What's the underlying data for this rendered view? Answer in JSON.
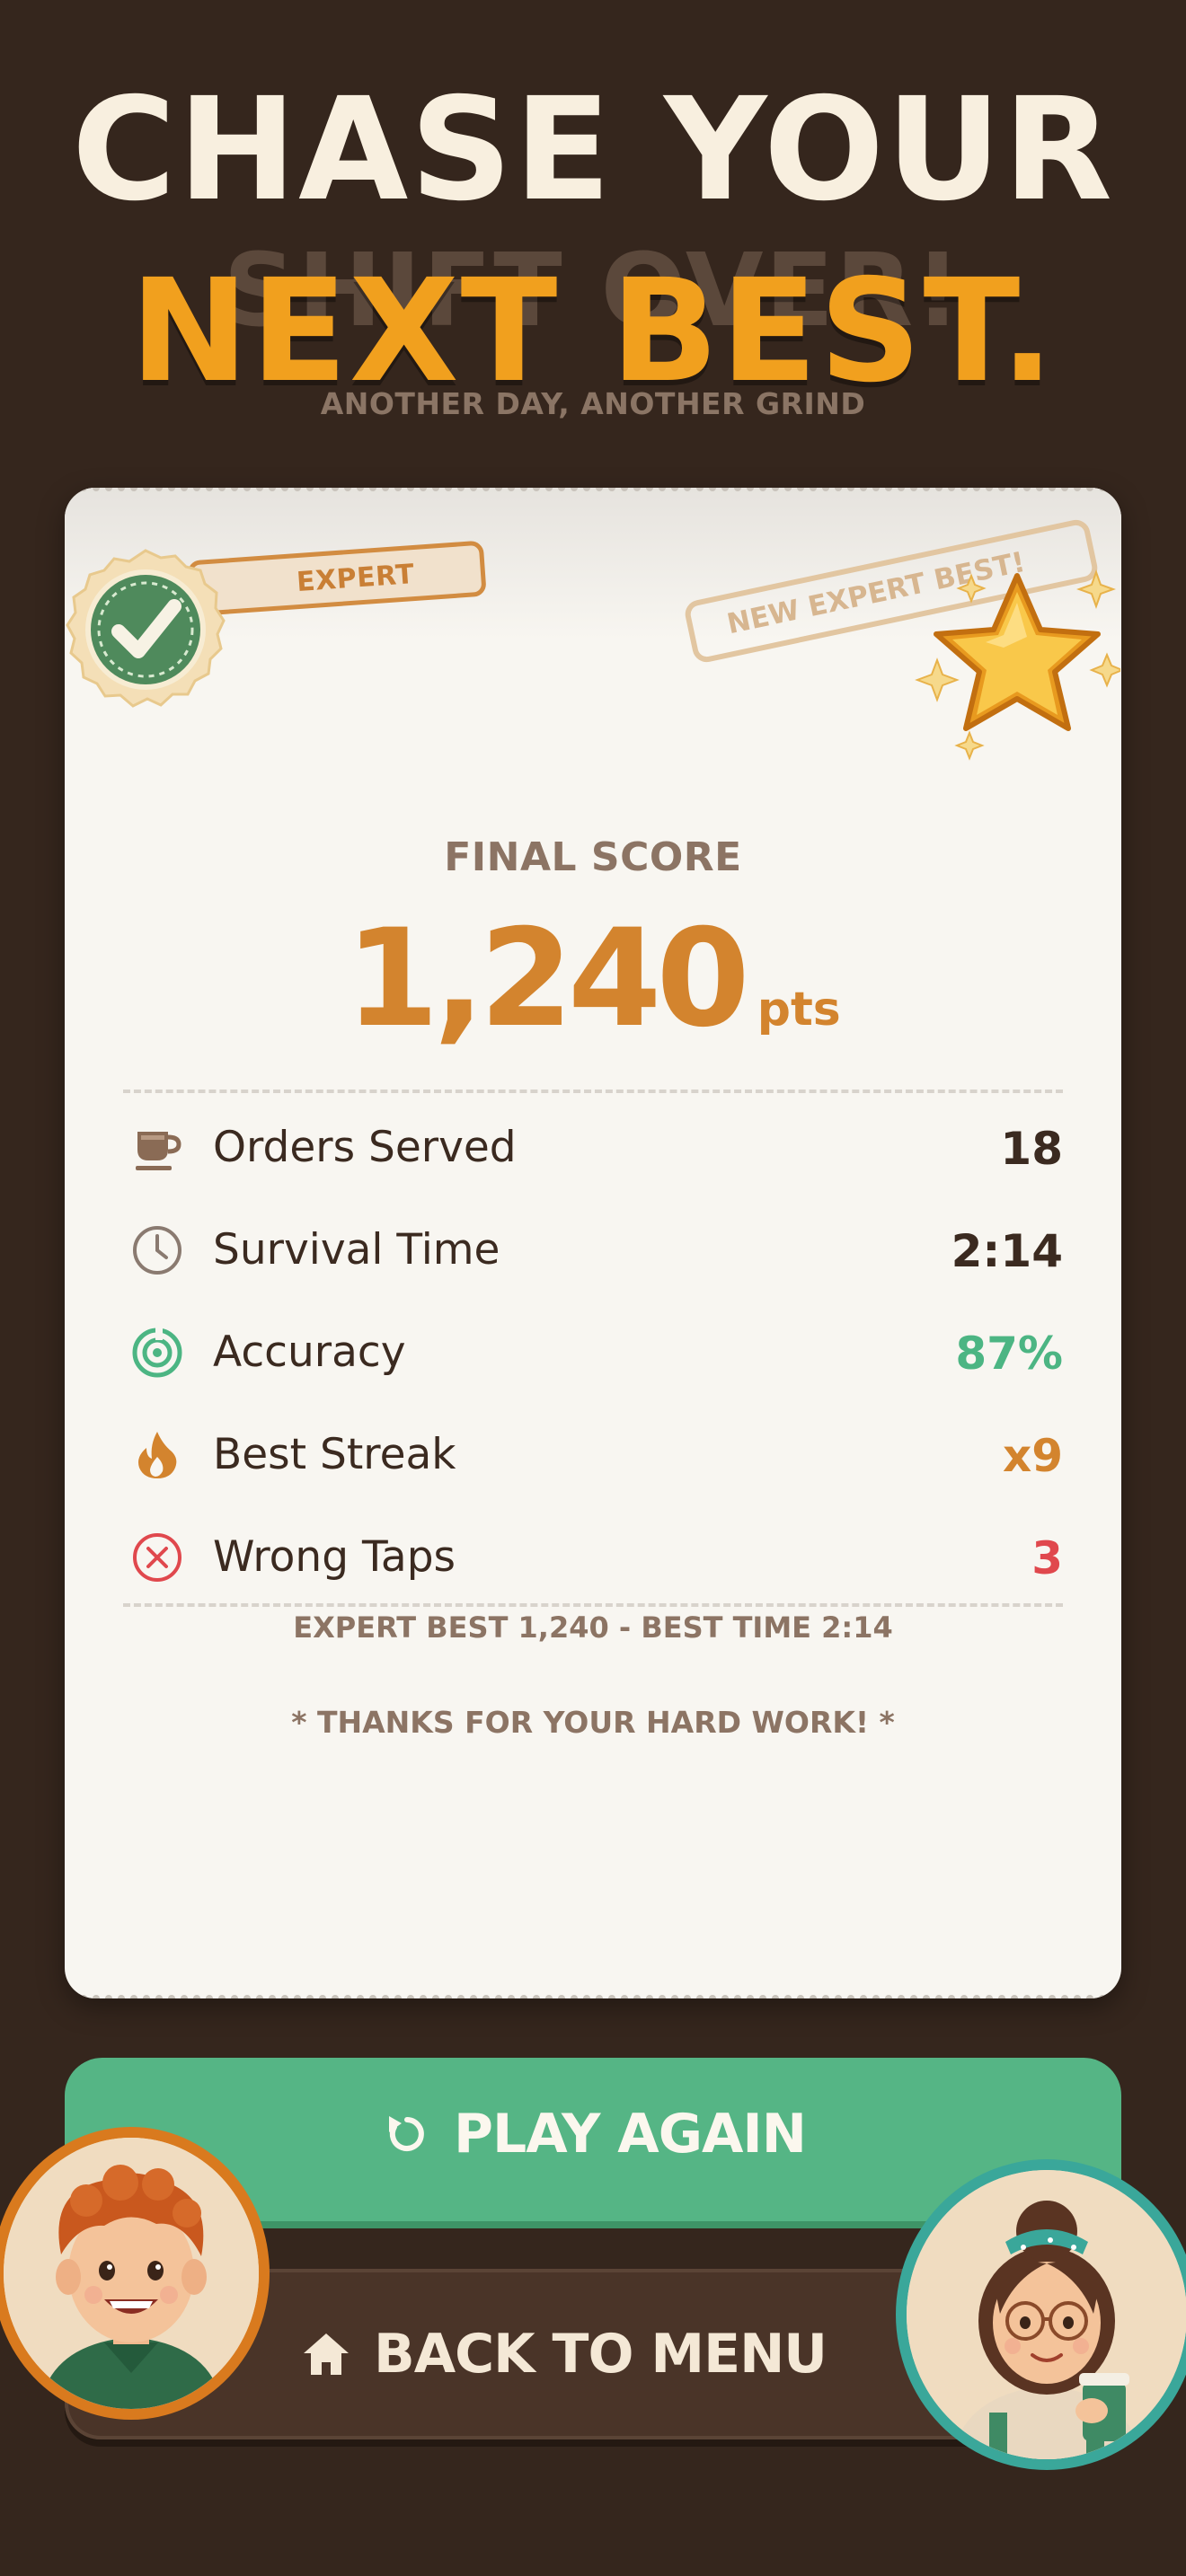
{
  "headline": {
    "line1": "CHASE YOUR",
    "line2": "NEXT BEST.",
    "ghost": "SHIFT OVER!",
    "subtitle": "ANOTHER DAY, ANOTHER GRIND"
  },
  "receipt": {
    "difficulty_tag": "EXPERT",
    "new_best_stamp": "NEW EXPERT BEST!",
    "final_score_label": "FINAL SCORE",
    "score": "1,240",
    "score_unit": "pts",
    "stats": [
      {
        "label": "Orders Served",
        "value": "18",
        "icon": "coffee-cup-icon",
        "color": "#3b2a20"
      },
      {
        "label": "Survival Time",
        "value": "2:14",
        "icon": "clock-icon",
        "color": "#3b2a20"
      },
      {
        "label": "Accuracy",
        "value": "87%",
        "icon": "target-icon",
        "color": "#4cb583"
      },
      {
        "label": "Best Streak",
        "value": "x9",
        "icon": "flame-icon",
        "color": "#d3842e"
      },
      {
        "label": "Wrong Taps",
        "value": "3",
        "icon": "x-circle-icon",
        "color": "#e0484d"
      }
    ],
    "footer_best": "EXPERT BEST 1,240  -  BEST TIME 2:14",
    "footer_thanks": "* THANKS FOR YOUR HARD WORK! *"
  },
  "buttons": {
    "play_again": "PLAY AGAIN",
    "back_to_menu": "BACK TO MENU"
  },
  "colors": {
    "background": "#35261d",
    "accent_orange": "#f1a01e",
    "score_orange": "#d3842e",
    "play_green": "#55b585",
    "menu_brown": "#4a3428"
  }
}
